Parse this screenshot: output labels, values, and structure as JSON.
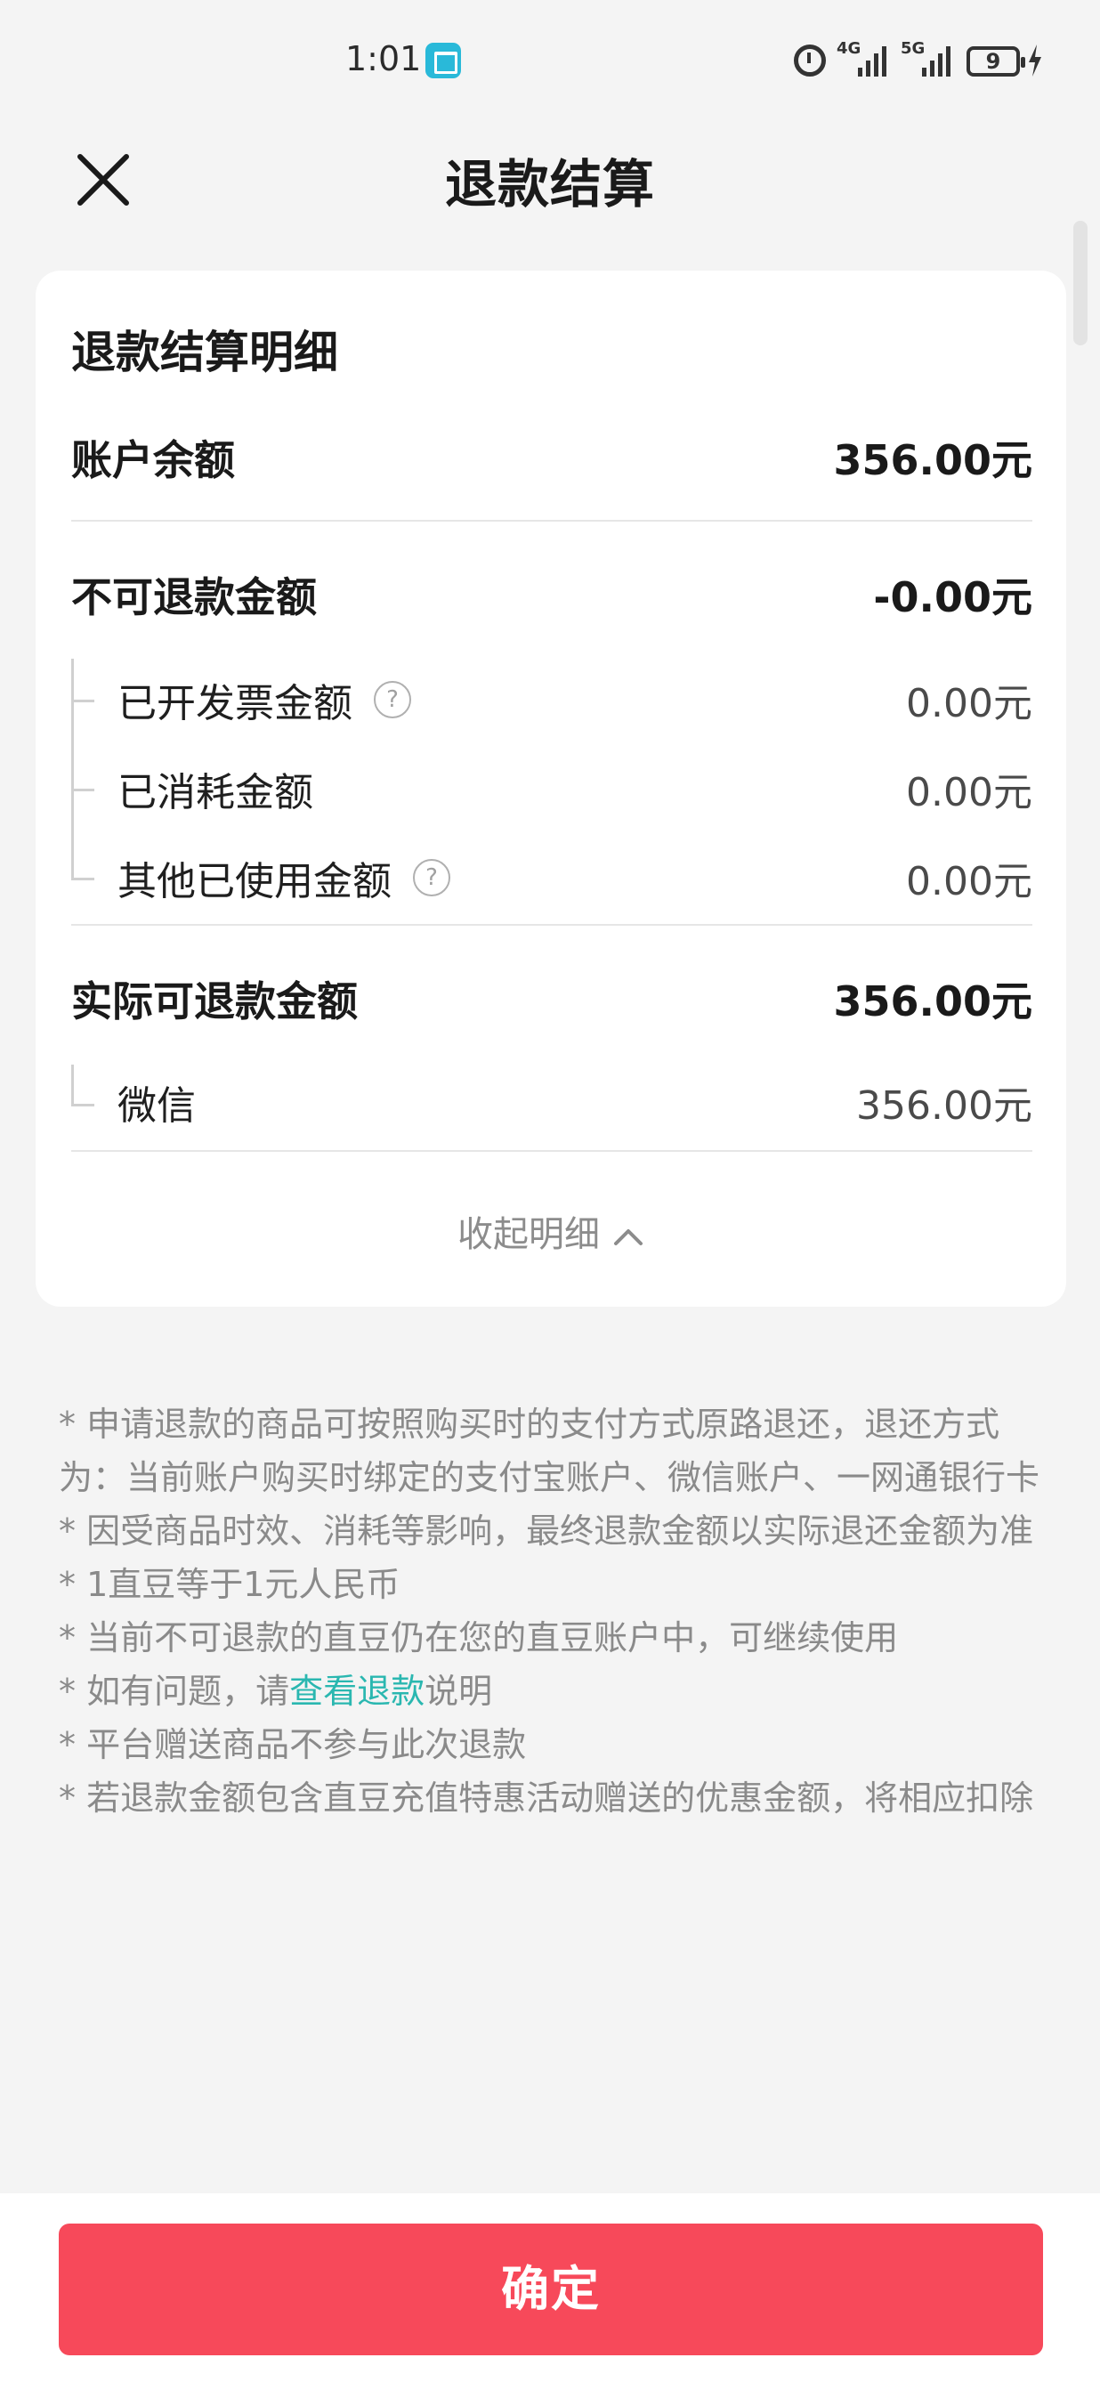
{
  "status_bar": {
    "time": "1:01",
    "signal1": "4G",
    "signal2": "5G",
    "battery": "9"
  },
  "header": {
    "title": "退款结算"
  },
  "card": {
    "title": "退款结算明细",
    "account_balance": {
      "label": "账户余额",
      "value": "356.00元"
    },
    "non_refundable": {
      "label": "不可退款金额",
      "value": "-0.00元"
    },
    "invoiced": {
      "label": "已开发票金额",
      "value": "0.00元"
    },
    "consumed": {
      "label": "已消耗金额",
      "value": "0.00元"
    },
    "other_used": {
      "label": "其他已使用金额",
      "value": "0.00元"
    },
    "actual_refundable": {
      "label": "实际可退款金额",
      "value": "356.00元"
    },
    "wechat": {
      "label": "微信",
      "value": "356.00元"
    },
    "collapse_label": "收起明细"
  },
  "notes": {
    "n1": "* 申请退款的商品可按照购买时的支付方式原路退还，退还方式为：当前账户购买时绑定的支付宝账户、微信账户、一网通银行卡",
    "n2": "* 因受商品时效、消耗等影响，最终退款金额以实际退还金额为准",
    "n3": "* 1直豆等于1元人民币",
    "n4": "* 当前不可退款的直豆仍在您的直豆账户中，可继续使用",
    "n5_prefix": "* 如有问题，请",
    "n5_link": "查看退款",
    "n5_suffix": "说明",
    "n6": "* 平台赠送商品不参与此次退款",
    "n7": "* 若退款金额包含直豆充值特惠活动赠送的优惠金额，将相应扣除"
  },
  "footer": {
    "confirm_label": "确定"
  },
  "colors": {
    "accent": "#f7495a",
    "link": "#2ab7b0",
    "background": "#f4f4f4"
  },
  "icons": [
    "close-icon",
    "help-icon",
    "chevron-up-icon",
    "alarm-icon",
    "battery-icon"
  ]
}
